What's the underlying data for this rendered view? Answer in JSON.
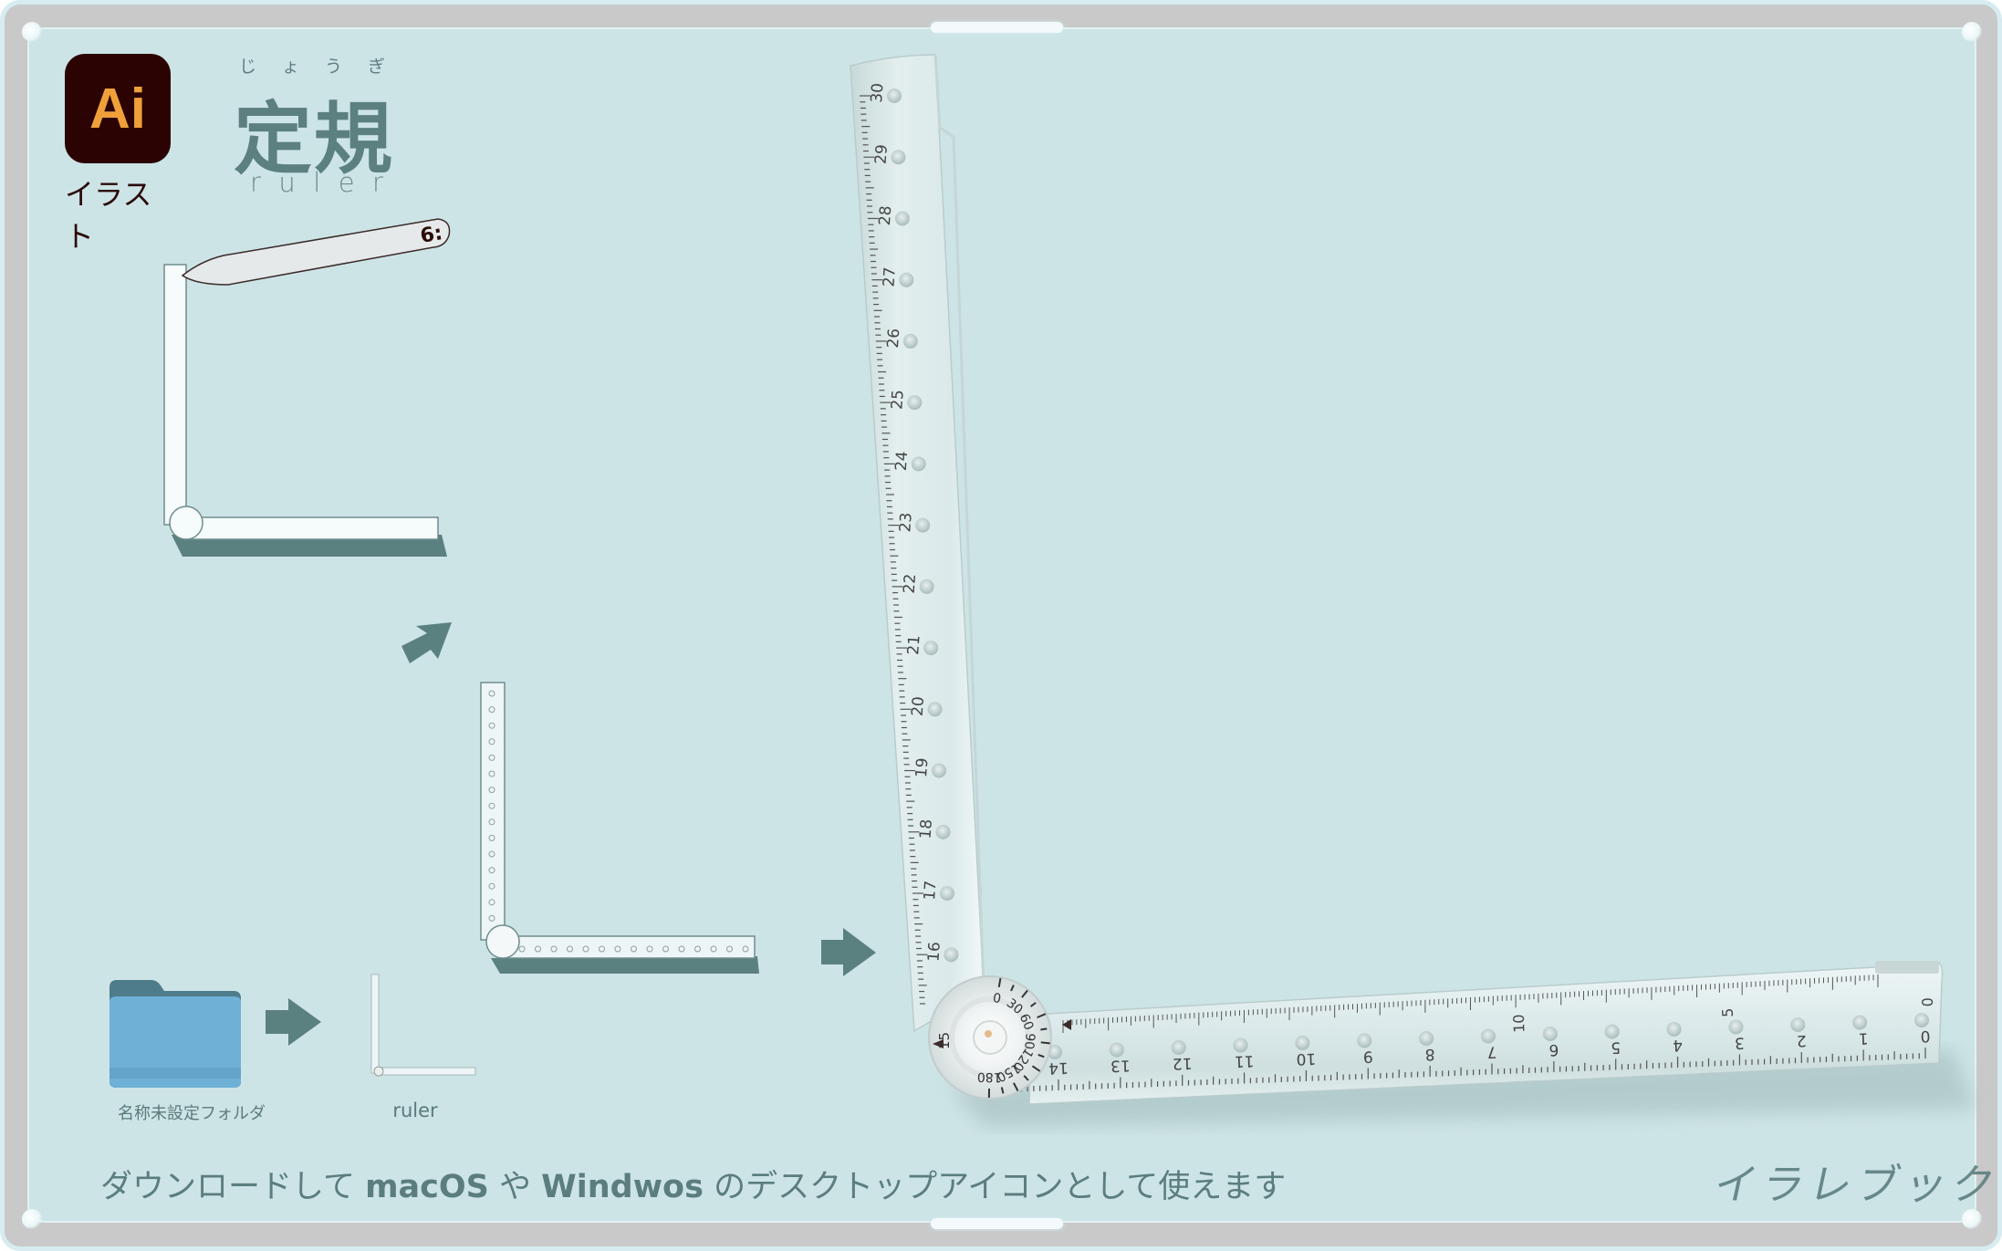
{
  "app": {
    "icon_label": "Ai",
    "icon_caption": "イラスト",
    "brand_color": "#2b0302",
    "icon_text_color": "#f0a03a"
  },
  "title": {
    "ruby": [
      "じ",
      "ょ",
      "う",
      "ぎ"
    ],
    "main": "定規",
    "sub": [
      "r",
      "u",
      "l",
      "e",
      "r"
    ]
  },
  "desktop": {
    "folder_label": "名称未設定フォルダ",
    "result_icon_label": "ruler"
  },
  "footer": {
    "prefix": "ダウンロードして ",
    "os1": "macOS",
    "mid": " や ",
    "os2": "Windwos",
    "suffix": " のデスクトップアイコンとして使えます"
  },
  "brand_logo": "イラレブック",
  "big_ruler": {
    "vertical_labels": [
      "30",
      "29",
      "28",
      "27",
      "26",
      "25",
      "24",
      "23",
      "22",
      "21",
      "20",
      "19",
      "18",
      "17",
      "16"
    ],
    "horizontal_labels": [
      "14",
      "13",
      "12",
      "11",
      "10",
      "9",
      "8",
      "7",
      "6",
      "5",
      "4",
      "3",
      "2",
      "1",
      "0"
    ],
    "horizontal_top_labels": [
      "10",
      "5",
      "0"
    ],
    "dial_labels": [
      "0",
      "30",
      "60",
      "90",
      "120",
      "150",
      "180"
    ],
    "dial_side_label": "15"
  },
  "colors": {
    "panel": "#cde4e6",
    "frame": "#c9c9c9",
    "accent": "#5c8080",
    "folder": "#6fb0d6"
  }
}
